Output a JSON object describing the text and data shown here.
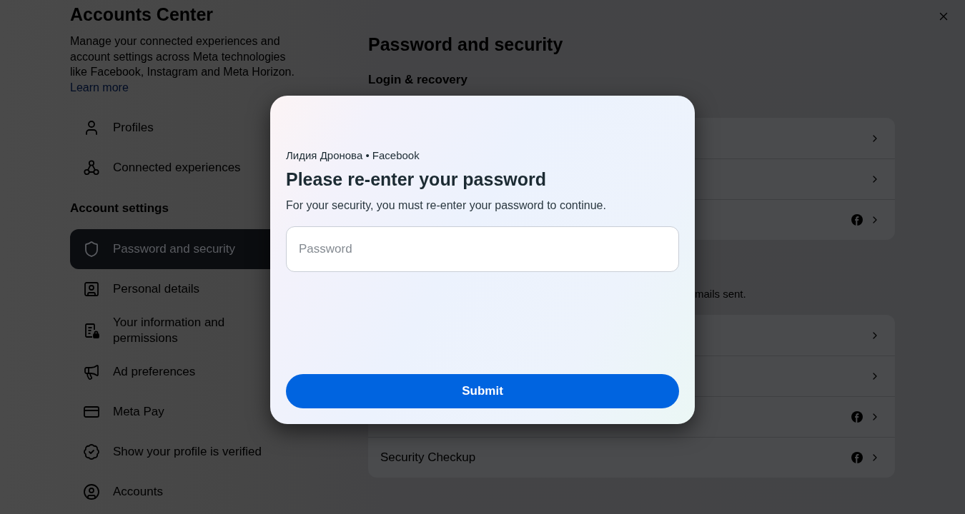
{
  "sidebar": {
    "title": "Accounts Center",
    "description": "Manage your connected experiences and account settings across Meta technologies like Facebook, Instagram and Meta Horizon.",
    "link": "Learn more",
    "items": [
      {
        "label": "Profiles",
        "selected": false
      },
      {
        "label": "Connected experiences",
        "selected": false
      }
    ],
    "section_title": "Account settings",
    "settings_items": [
      {
        "label": "Password and security",
        "selected": true
      },
      {
        "label": "Personal details",
        "selected": false
      },
      {
        "label": "Your information and permissions",
        "selected": false
      },
      {
        "label": "Ad preferences",
        "selected": false
      },
      {
        "label": "Meta Pay",
        "selected": false
      },
      {
        "label": "Show your profile is verified",
        "selected": false
      },
      {
        "label": "Accounts",
        "selected": false
      }
    ]
  },
  "content": {
    "title": "Password and security",
    "section_title": "Login & recovery",
    "cards": [
      {
        "rows": [
          {
            "badge": false
          },
          {
            "badge": false
          },
          {
            "badge": true
          }
        ]
      },
      {
        "note": "mails sent.",
        "rows": [
          {
            "badge": false
          },
          {
            "badge": false
          },
          {
            "badge": true
          },
          {
            "label": "Security Checkup",
            "badge": true
          }
        ]
      }
    ]
  },
  "dialog": {
    "account": "Лидия Дронова • Facebook",
    "title": "Please re-enter your password",
    "text": "For your security, you must re-enter your password to continue.",
    "password": {
      "placeholder": "Password"
    },
    "submit": "Submit"
  }
}
